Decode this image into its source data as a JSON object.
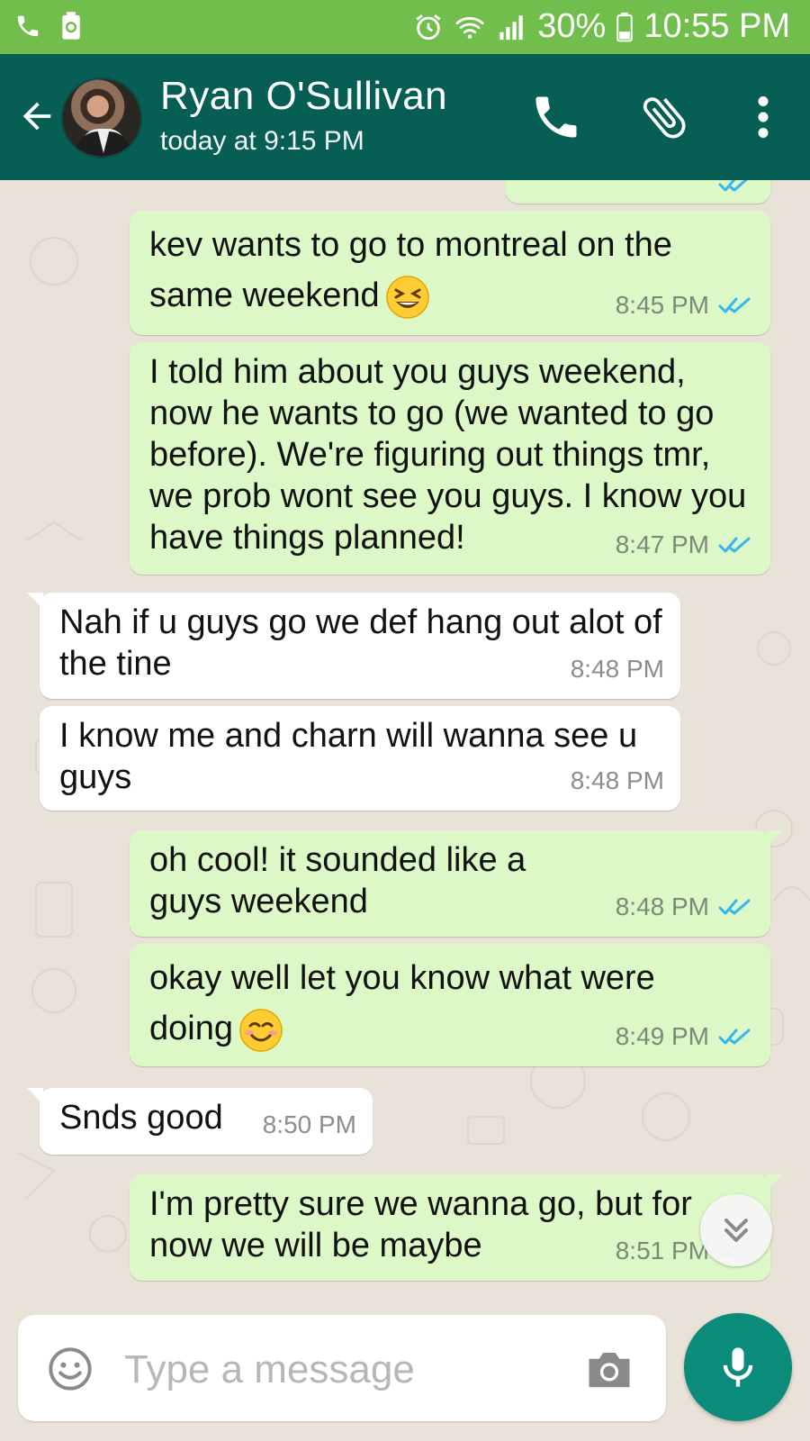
{
  "status_bar": {
    "battery": "30%",
    "time": "10:55 PM",
    "icons": [
      "phone-call-icon",
      "recycle-battery-icon",
      "alarm-icon",
      "wifi-icon",
      "signal-icon",
      "battery-icon"
    ]
  },
  "header": {
    "contact_name": "Ryan O'Sullivan",
    "last_seen": "today at 9:15 PM",
    "icons": [
      "back-arrow-icon",
      "avatar",
      "phone-icon",
      "paperclip-icon",
      "more-vert-icon"
    ]
  },
  "messages": [
    {
      "direction": "out",
      "text": "kev wants to go to montreal on the same weekend",
      "emoji": "grinning-squinting-face",
      "time": "8:45 PM",
      "status": "read"
    },
    {
      "direction": "out",
      "text": "I told him about you guys weekend, now he wants to go (we wanted to go before). We're figuring out things tmr, we prob wont see you guys. I know you have things planned!",
      "time": "8:47 PM",
      "status": "read"
    },
    {
      "direction": "in",
      "text": "Nah if u guys go we def hang out alot of the tine",
      "time": "8:48 PM"
    },
    {
      "direction": "in",
      "text": "I know me and charn will wanna see u guys",
      "time": "8:48 PM"
    },
    {
      "direction": "out",
      "text": "oh cool! it sounded like a guys weekend",
      "time": "8:48 PM",
      "status": "read"
    },
    {
      "direction": "out",
      "text": "okay well let you know what were doing",
      "emoji": "smiling-face",
      "time": "8:49 PM",
      "status": "read"
    },
    {
      "direction": "in",
      "text": "Snds good",
      "time": "8:50 PM"
    },
    {
      "direction": "out",
      "text": "I'm pretty sure we wanna go, but for now we will be maybe",
      "time": "8:51 PM",
      "status": "read"
    }
  ],
  "composer": {
    "placeholder": "Type a message",
    "icons": [
      "emoji-icon",
      "camera-icon",
      "mic-icon",
      "scroll-down-icon"
    ]
  },
  "colors": {
    "status_bar": "#72be4c",
    "header": "#075e54",
    "outgoing_bubble": "#dcf8c6",
    "incoming_bubble": "#ffffff",
    "chat_background": "#e9e2d8",
    "read_ticks": "#34b7f1",
    "mic_button": "#0b8c7a"
  }
}
